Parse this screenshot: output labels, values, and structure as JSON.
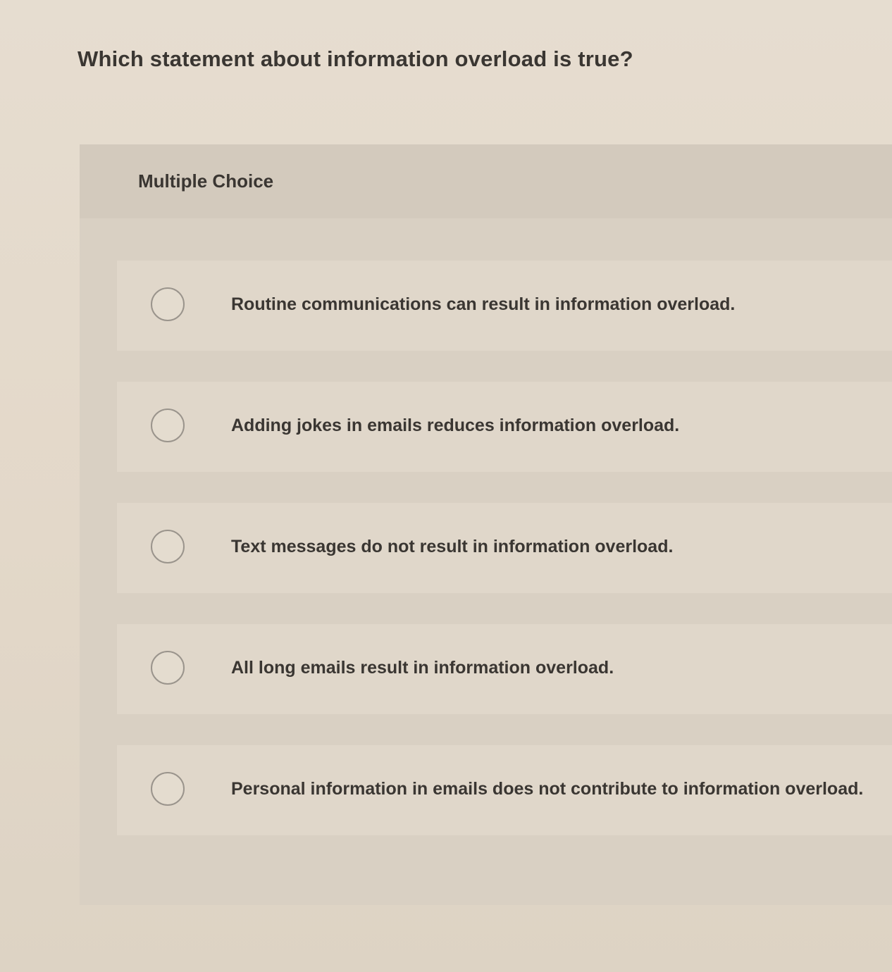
{
  "question": {
    "text": "Which statement about information overload is true?"
  },
  "card": {
    "header_label": "Multiple Choice"
  },
  "options": [
    {
      "label": "Routine communications can result in information overload."
    },
    {
      "label": "Adding jokes in emails reduces information overload."
    },
    {
      "label": "Text messages do not result in information overload."
    },
    {
      "label": "All long emails result in information overload."
    },
    {
      "label": "Personal information in emails does not contribute to information overload."
    }
  ],
  "colors": {
    "page_background": "#e4dacb",
    "card_background": "#d9d0c3",
    "header_background": "#d3cabd",
    "option_background": "#e0d7ca",
    "text": "#3a3632",
    "radio_border": "#9a948c"
  }
}
